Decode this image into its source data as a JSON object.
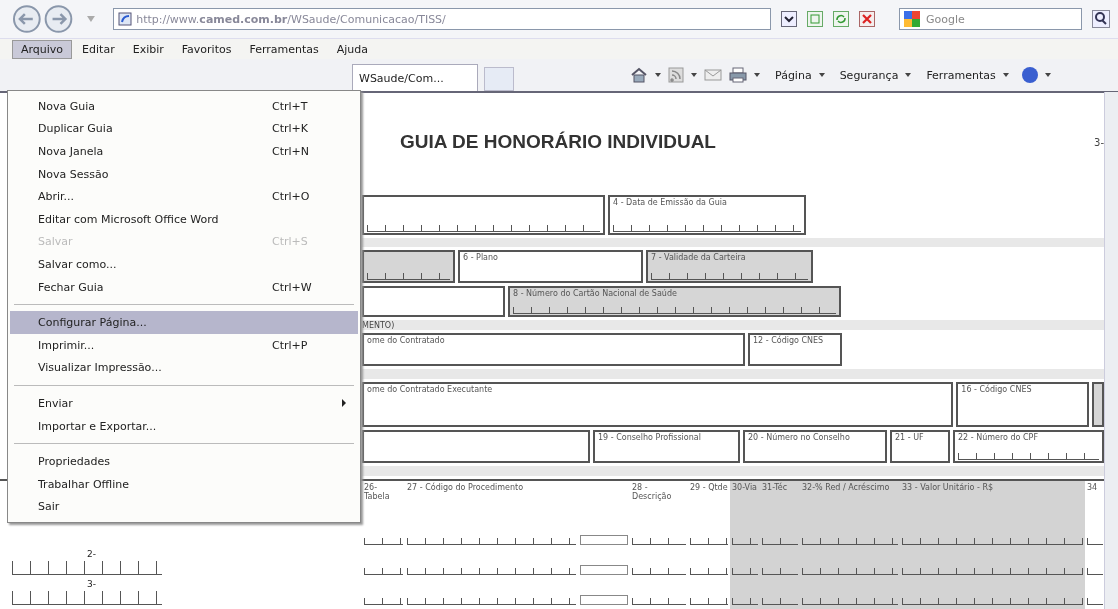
{
  "browser": {
    "address": "http://www.**camed.com.br**/WSaude/Comunicacao/TISS/",
    "search_placeholder": "Google"
  },
  "menu_bar": [
    {
      "label": "Arquivo",
      "selected": true
    },
    {
      "label": "Editar",
      "selected": false
    },
    {
      "label": "Exibir",
      "selected": false
    },
    {
      "label": "Favoritos",
      "selected": false
    },
    {
      "label": "Ferramentas",
      "selected": false
    },
    {
      "label": "Ajuda",
      "selected": false
    }
  ],
  "tab": {
    "title": "WSaude/Com..."
  },
  "command_bar": [
    "Página",
    "Segurança",
    "Ferramentas"
  ],
  "file_menu": [
    {
      "kind": "item",
      "label": "Nova Guia",
      "shortcut": "Ctrl+T",
      "disabled": false,
      "selected": false
    },
    {
      "kind": "item",
      "label": "Duplicar Guia",
      "shortcut": "Ctrl+K",
      "disabled": false,
      "selected": false
    },
    {
      "kind": "item",
      "label": "Nova Janela",
      "shortcut": "Ctrl+N",
      "disabled": false,
      "selected": false
    },
    {
      "kind": "item",
      "label": "Nova Sessão",
      "disabled": false,
      "selected": false
    },
    {
      "kind": "item",
      "label": "Abrir...",
      "shortcut": "Ctrl+O",
      "disabled": false,
      "selected": false
    },
    {
      "kind": "item",
      "label": "Editar com Microsoft Office Word",
      "disabled": false,
      "selected": false
    },
    {
      "kind": "item",
      "label": "Salvar",
      "shortcut": "Ctrl+S",
      "disabled": true,
      "selected": false
    },
    {
      "kind": "item",
      "label": "Salvar como...",
      "disabled": false,
      "selected": false
    },
    {
      "kind": "item",
      "label": "Fechar Guia",
      "shortcut": "Ctrl+W",
      "disabled": false,
      "selected": false
    },
    {
      "kind": "separator"
    },
    {
      "kind": "item",
      "label": "Configurar Página...",
      "disabled": false,
      "selected": true
    },
    {
      "kind": "item",
      "label": "Imprimir...",
      "shortcut": "Ctrl+P",
      "disabled": false,
      "selected": false
    },
    {
      "kind": "item",
      "label": "Visualizar Impressão...",
      "disabled": false,
      "selected": false
    },
    {
      "kind": "separator"
    },
    {
      "kind": "submenu",
      "label": "Enviar",
      "disabled": false,
      "selected": false
    },
    {
      "kind": "item",
      "label": "Importar e Exportar...",
      "disabled": false,
      "selected": false
    },
    {
      "kind": "separator"
    },
    {
      "kind": "item",
      "label": "Propriedades",
      "disabled": false,
      "selected": false
    },
    {
      "kind": "item",
      "label": "Trabalhar Offline",
      "disabled": false,
      "selected": false
    },
    {
      "kind": "item",
      "label": "Sair",
      "disabled": false,
      "selected": false
    }
  ],
  "document": {
    "title": "GUIA DE HONORÁRIO INDIVIDUAL",
    "corner_text": "3-",
    "sections": [
      {
        "kind": "fields",
        "fields": [
          {
            "digits": true,
            "shaded": false
          },
          {
            "label": "4 - Data de Emissão da Guia",
            "digits": true,
            "shaded": false
          }
        ]
      },
      {
        "kind": "strip"
      },
      {
        "kind": "fields",
        "fields": [
          {
            "digits": true,
            "shaded": true
          },
          {
            "label": "6 - Plano",
            "digits": false,
            "shaded": false
          },
          {
            "label": "7 - Validade da Carteira",
            "digits": true,
            "shaded": true
          }
        ]
      },
      {
        "kind": "fields",
        "fields": [
          {
            "digits": false,
            "shaded": false
          },
          {
            "label": "8 - Número do Cartão Nacional de Saúde",
            "digits": true,
            "shaded": true
          }
        ]
      },
      {
        "kind": "strip",
        "label": "MENTO)"
      },
      {
        "kind": "fields",
        "fields": [
          {
            "label": "ome do Contratado",
            "digits": false,
            "shaded": false
          },
          {
            "label": "12 - Código CNES",
            "digits": false,
            "shaded": false
          }
        ]
      },
      {
        "kind": "strip"
      },
      {
        "kind": "fields",
        "fields": [
          {
            "label": "ome do Contratado Executante",
            "digits": false,
            "shaded": false
          },
          {
            "label": "16 - Código CNES",
            "digits": false,
            "shaded": false
          },
          {
            "digits": false,
            "shaded": true
          }
        ]
      },
      {
        "kind": "fields",
        "fields": [
          {
            "digits": false,
            "shaded": false
          },
          {
            "label": "19 - Conselho Profissional",
            "digits": false,
            "shaded": false
          },
          {
            "label": "20 - Número no Conselho",
            "digits": false,
            "shaded": false
          },
          {
            "label": "21 - UF",
            "digits": false,
            "shaded": false
          },
          {
            "label": "22 - Número do CPF",
            "digits": true,
            "shaded": false
          }
        ]
      },
      {
        "kind": "strip"
      }
    ]
  },
  "procedures": {
    "columns": [
      {
        "kind": "ticks",
        "label": "26- Tabela",
        "shaded": false
      },
      {
        "kind": "ticks",
        "label": "27 - Código do Procedimento",
        "shaded": false
      },
      {
        "kind": "box",
        "shaded": false
      },
      {
        "kind": "ticks",
        "label": "28 - Descrição",
        "shaded": false
      },
      {
        "kind": "ticks",
        "label": "29 - Qtde",
        "shaded": false
      },
      {
        "kind": "ticks",
        "label": "30-Via",
        "shaded": true
      },
      {
        "kind": "ticks",
        "label": "31-Téc",
        "shaded": true
      },
      {
        "kind": "ticks",
        "label": "32-% Red / Acréscimo",
        "shaded": true
      },
      {
        "kind": "ticks",
        "label": "33 - Valor Unitário - R$",
        "shaded": true
      },
      {
        "kind": "ticks",
        "label": "34",
        "shaded": false
      }
    ],
    "rows": [
      {},
      {
        "number": "2-"
      },
      {
        "number": "3-"
      }
    ]
  }
}
